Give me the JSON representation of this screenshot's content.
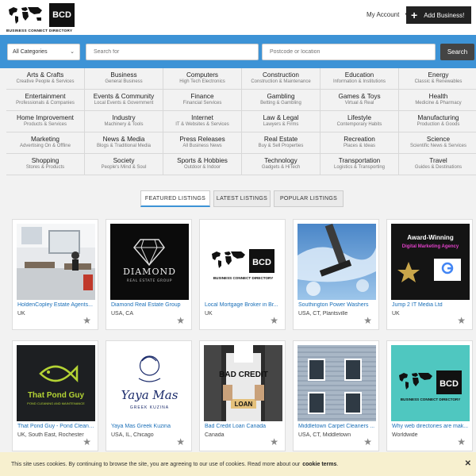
{
  "brand": {
    "logo_abbr": "BCD",
    "logo_text": "BUSINESS CONNECT DIRECTORY"
  },
  "header": {
    "account_label": "My Account",
    "add_business_label": "Add Business!"
  },
  "search": {
    "category_selected": "All Categories",
    "query_placeholder": "Search for",
    "location_placeholder": "Postcode or location",
    "button_label": "Search"
  },
  "categories": [
    {
      "name": "Arts & Crafts",
      "sub": "Creative People & Services"
    },
    {
      "name": "Business",
      "sub": "General Business"
    },
    {
      "name": "Computers",
      "sub": "High Tech Electronics"
    },
    {
      "name": "Construction",
      "sub": "Construction & Maintenance"
    },
    {
      "name": "Education",
      "sub": "Information & Institutions"
    },
    {
      "name": "Energy",
      "sub": "Classic & Renewables"
    },
    {
      "name": "Entertainment",
      "sub": "Professionals & Companies"
    },
    {
      "name": "Events & Community",
      "sub": "Local Events & Government"
    },
    {
      "name": "Finance",
      "sub": "Financial Services"
    },
    {
      "name": "Gambling",
      "sub": "Betting & Gambling"
    },
    {
      "name": "Games & Toys",
      "sub": "Virtual & Real"
    },
    {
      "name": "Health",
      "sub": "Medicine & Pharmacy"
    },
    {
      "name": "Home Improvement",
      "sub": "Products & Services"
    },
    {
      "name": "Industry",
      "sub": "Machinery & Tools"
    },
    {
      "name": "Internet",
      "sub": "IT & Websites & Services"
    },
    {
      "name": "Law & Legal",
      "sub": "Lawyers & Firms"
    },
    {
      "name": "Lifestyle",
      "sub": "Contemporary Habits"
    },
    {
      "name": "Manufacturing",
      "sub": "Production & Goods"
    },
    {
      "name": "Marketing",
      "sub": "Advertising On & Offline"
    },
    {
      "name": "News & Media",
      "sub": "Blogs & Traditional Media"
    },
    {
      "name": "Press Releases",
      "sub": "All Business News"
    },
    {
      "name": "Real Estate",
      "sub": "Buy & Sell Properties"
    },
    {
      "name": "Recreation",
      "sub": "Places & Ideas"
    },
    {
      "name": "Science",
      "sub": "Scientific News & Services"
    },
    {
      "name": "Shopping",
      "sub": "Stores & Products"
    },
    {
      "name": "Society",
      "sub": "People's Mind & Soul"
    },
    {
      "name": "Sports & Hobbies",
      "sub": "Outdoor & Indoor"
    },
    {
      "name": "Technology",
      "sub": "Gadgets & HiTech"
    },
    {
      "name": "Transportation",
      "sub": "Logistics & Transporting"
    },
    {
      "name": "Travel",
      "sub": "Guides & Destinations"
    }
  ],
  "tabs": [
    {
      "label": "FEATURED LISTINGS",
      "active": true
    },
    {
      "label": "LATEST LISTINGS",
      "active": false
    },
    {
      "label": "POPULAR LISTINGS",
      "active": false
    }
  ],
  "listings": [
    {
      "title": "HoldenCopley Estate Agents...",
      "location": "UK",
      "thumb": "office-photo"
    },
    {
      "title": "Diamond Real Estate Group",
      "location": "USA, CA",
      "thumb": "diamond-logo",
      "thumb_text": "DIAMOND",
      "thumb_sub": "REAL ESTATE GROUP"
    },
    {
      "title": "Local Mortgage Broker in Br...",
      "location": "UK",
      "thumb": "bcd-logo"
    },
    {
      "title": "Southington Power Washers",
      "location": "USA, CT, Plantsville",
      "thumb": "window-cleaning-photo"
    },
    {
      "title": "Jump 2 IT Media Ltd",
      "location": "UK",
      "thumb": "award-graphic",
      "thumb_text": "Award-Winning",
      "thumb_sub": "Digital Marketing Agency"
    },
    {
      "title": "That Pond Guy - Pond Cleani...",
      "location": "UK, South East, Rochester",
      "thumb": "pond-guy-logo",
      "thumb_text": "That Pond Guy",
      "thumb_sub": "POND CLEANING AND MAINTENANCE"
    },
    {
      "title": "Yaya Mas Greek Kuzina",
      "location": "USA, IL, Chicago",
      "thumb": "yaya-logo",
      "thumb_text": "Yaya Mas",
      "thumb_sub": "GREEK KUZINA"
    },
    {
      "title": "Bad Credit Loan Canada",
      "location": "Canada",
      "thumb": "bad-credit-photo",
      "thumb_text": "BAD CREDIT",
      "thumb_sub": "LOAN"
    },
    {
      "title": "Middletown Carpet Cleaners ...",
      "location": "USA, CT, Middletown",
      "thumb": "house-siding-photo"
    },
    {
      "title": "Why web directories are mak...",
      "location": "Worldwide",
      "thumb": "bcd-logo-teal"
    }
  ],
  "cookie": {
    "text": "This site uses cookies. By continuing to browse the site, you are agreeing to our use of cookies. Read more about our",
    "link": "cookie terms",
    "end": "."
  },
  "colors": {
    "accent": "#3d93d6",
    "link": "#1a6fb8",
    "cookie_bg": "#f7f0cf"
  }
}
